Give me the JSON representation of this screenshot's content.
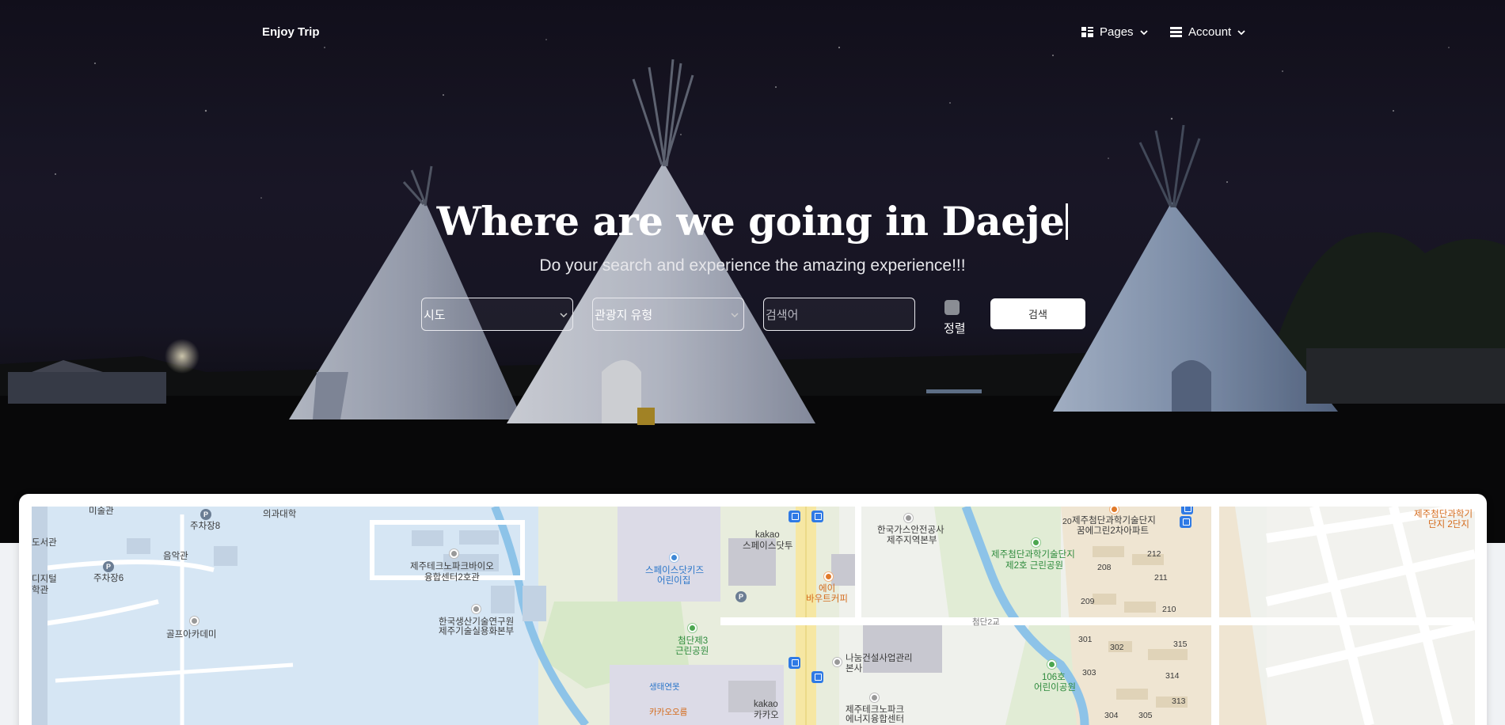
{
  "nav": {
    "brand": "Enjoy Trip",
    "pages_label": "Pages",
    "account_label": "Account"
  },
  "hero": {
    "title": "Where are we going in Daeje",
    "subtitle": "Do your search and experience the amazing experience!!!"
  },
  "search": {
    "sido_selected": "시도",
    "type_selected": "관광지 유형",
    "keyword_placeholder": "검색어",
    "sort_label": "정렬",
    "button_label": "검색"
  },
  "map": {
    "labels": {
      "l1": "미술관",
      "l2": "주차장8",
      "l3": "의과대학",
      "l4": "도서관",
      "l5": "음악관",
      "l6": "주차장6",
      "l7": "디지털",
      "l8": "학관",
      "l9": "제주테크노파크바이오",
      "l10": "융합센터2호관",
      "l11": "골프아카데미",
      "l12": "한국생산기술연구원",
      "l13": "제주기술실용화본부",
      "l14": "스페이스닷키즈",
      "l15": "어린이집",
      "l16": "첨단제3",
      "l17": "근린공원",
      "l18": "생태연못",
      "l19": "카카오오름",
      "l20": "kakao",
      "l21": "스페이스닷투",
      "l22": "에이",
      "l23": "바우트커피",
      "l24": "kakao",
      "l25": "카카오",
      "l26": "한국가스안전공사",
      "l27": "제주지역본부",
      "l28": "나눔건설사업관리",
      "l29": "본사",
      "l30": "제주테크노파크",
      "l31": "에너지융합센터",
      "l32": "첨단2교",
      "l33": "제주첨단과학기술단지",
      "l34": "제2호 근린공원",
      "l35": "20",
      "l36": "제주첨단과학기술단지",
      "l37": "꿈에그린2차아파트",
      "l38": "212",
      "l39": "208",
      "l40": "211",
      "l41": "209",
      "l42": "210",
      "l43": "301",
      "l44": "302",
      "l45": "315",
      "l46": "303",
      "l47": "314",
      "l48": "313",
      "l49": "304",
      "l50": "305",
      "l51": "106호",
      "l52": "어린이공원",
      "l53": "제주첨단과학기",
      "l54": "단지 2단지",
      "p_label": "P"
    }
  },
  "colors": {
    "water": "#cfe2f3",
    "park": "#e3eedb",
    "road": "#ffffff",
    "highway": "#f6e7a3",
    "residential": "#efe6d4",
    "river": "#8dc3e8"
  }
}
